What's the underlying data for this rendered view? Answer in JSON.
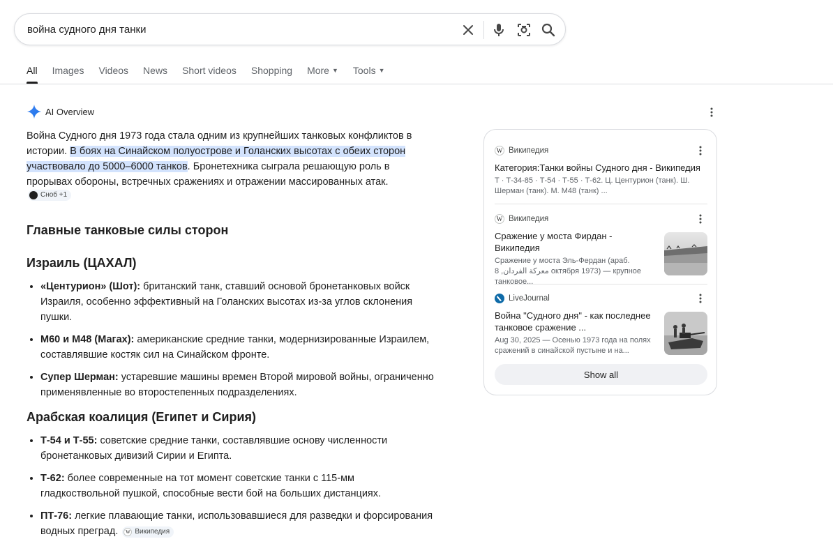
{
  "search": {
    "query": "война судного дня танки",
    "icons": [
      "close-icon",
      "mic-icon",
      "camera-search-icon",
      "search-icon"
    ]
  },
  "tabs": [
    {
      "label": "All",
      "active": true
    },
    {
      "label": "Images"
    },
    {
      "label": "Videos"
    },
    {
      "label": "News"
    },
    {
      "label": "Short videos"
    },
    {
      "label": "Shopping"
    },
    {
      "label": "More"
    },
    {
      "label": "Tools"
    }
  ],
  "overview": {
    "title": "AI Overview",
    "intro_plain1": "Война Судного дня 1973 года стала одним из крупнейших танковых конфликтов в истории. ",
    "intro_highlight": "В боях на Синайском полуострове и Голанских высотах с обеих сторон участвовало до 5000–6000 танков",
    "intro_plain2": ". Бронетехника сыграла решающую роль в прорывах обороны, встречных сражениях и отражении массированных атак.",
    "intro_chip": "Сноб +1",
    "heading_main": "Главные танковые силы сторон",
    "heading_israel": "Израиль (ЦАХАЛ)",
    "israel_items": [
      {
        "term": "«Центурион» (Шот):",
        "text": " британский танк, ставший основой бронетанковых войск Израиля, особенно эффективный на Голанских высотах из-за углов склонения пушки."
      },
      {
        "term": "M60 и M48 (Магах):",
        "text": " американские средние танки, модернизированные Израилем, составлявшие костяк сил на Синайском фронте."
      },
      {
        "term": "Супер Шерман:",
        "text": " устаревшие машины времен Второй мировой войны, ограниченно применявленные во второстепенных подразделениях."
      }
    ],
    "heading_arab": "Арабская коалиция (Египет и Сирия)",
    "arab_items": [
      {
        "term": "Т-54 и Т-55:",
        "text": " советские средние танки, составлявшие основу численности бронетанковых дивизий Сирии и Египта."
      },
      {
        "term": "Т-62:",
        "text": " более современные на тот момент советские танки с 115-мм гладкоствольной пушкой, способные вести бой на больших дистанциях."
      },
      {
        "term": "ПТ-76:",
        "text": " легкие плавающие танки, использовавшиеся для разведки и форсирования водных преград."
      }
    ],
    "last_chip": "Википедия"
  },
  "sources": [
    {
      "site": "Википедия",
      "favicon": "W",
      "title": "Категория:Танки войны Судного дня - Википедия",
      "desc": "Т · Т-34-85 · Т-54 · Т-55 · Т-62. Ц. Центурион (танк). Ш. Шерман (танк). М. М48 (танк) ..."
    },
    {
      "site": "Википедия",
      "favicon": "W",
      "title": "Сражение у моста Фирдан - Википедия",
      "desc": "Сражение у моста Эль-Фердан (араб. معركة الفردان, 8 октября 1973) — крупное танковое..."
    },
    {
      "site": "LiveJournal",
      "favicon": "",
      "title": "Война \"Судного дня\" - как последнее танковое сражение ...",
      "desc": "Aug 30, 2025 — Осенью 1973 года на полях сражений в синайской пустыне и на..."
    }
  ],
  "show_all": "Show all"
}
